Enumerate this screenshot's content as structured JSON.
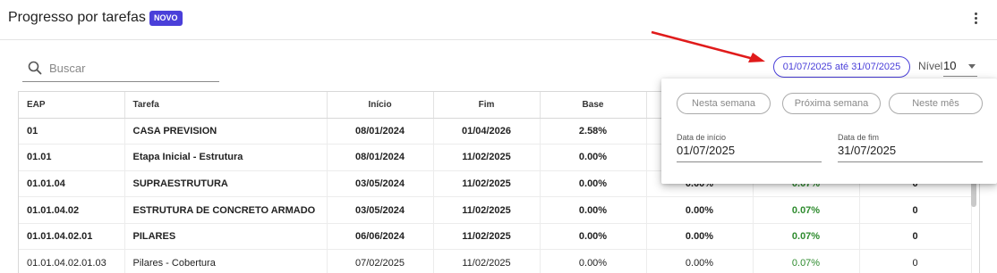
{
  "header": {
    "title": "Progresso por tarefas",
    "badge": "NOVO"
  },
  "search": {
    "placeholder": "Buscar"
  },
  "date_range": {
    "label": "01/07/2025 até 31/07/2025"
  },
  "nivel": {
    "label": "Nível",
    "value": "10"
  },
  "annotation": {
    "arrow_color": "#e01b1b"
  },
  "colors": {
    "accent": "#4a3fd9",
    "positive": "#2e8b2e"
  },
  "table": {
    "headers": [
      "EAP",
      "Tarefa",
      "Início",
      "Fim",
      "Base",
      "",
      "",
      ""
    ],
    "rows": [
      {
        "bold": true,
        "cells": [
          "01",
          "CASA PREVISION",
          "08/01/2024",
          "01/04/2026",
          "2.58%",
          "",
          "",
          ""
        ]
      },
      {
        "bold": true,
        "cells": [
          "01.01",
          "Etapa Inicial - Estrutura",
          "08/01/2024",
          "11/02/2025",
          "0.00%",
          "",
          "",
          ""
        ]
      },
      {
        "bold": true,
        "cells": [
          "01.01.04",
          "SUPRAESTRUTURA",
          "03/05/2024",
          "11/02/2025",
          "0.00%",
          "0.00%",
          "0.07%",
          "0"
        ]
      },
      {
        "bold": true,
        "cells": [
          "01.01.04.02",
          "ESTRUTURA DE CONCRETO ARMADO",
          "03/05/2024",
          "11/02/2025",
          "0.00%",
          "0.00%",
          "0.07%",
          "0"
        ]
      },
      {
        "bold": true,
        "cells": [
          "01.01.04.02.01",
          "PILARES",
          "06/06/2024",
          "11/02/2025",
          "0.00%",
          "0.00%",
          "0.07%",
          "0"
        ]
      },
      {
        "bold": false,
        "cells": [
          "01.01.04.02.01.03",
          "Pilares - Cobertura",
          "07/02/2025",
          "11/02/2025",
          "0.00%",
          "0.00%",
          "0.07%",
          "0"
        ]
      }
    ]
  },
  "popup": {
    "quick": [
      "Nesta semana",
      "Próxima semana",
      "Neste mês"
    ],
    "start_label": "Data de início",
    "start_value": "01/07/2025",
    "end_label": "Data de fim",
    "end_value": "31/07/2025"
  }
}
